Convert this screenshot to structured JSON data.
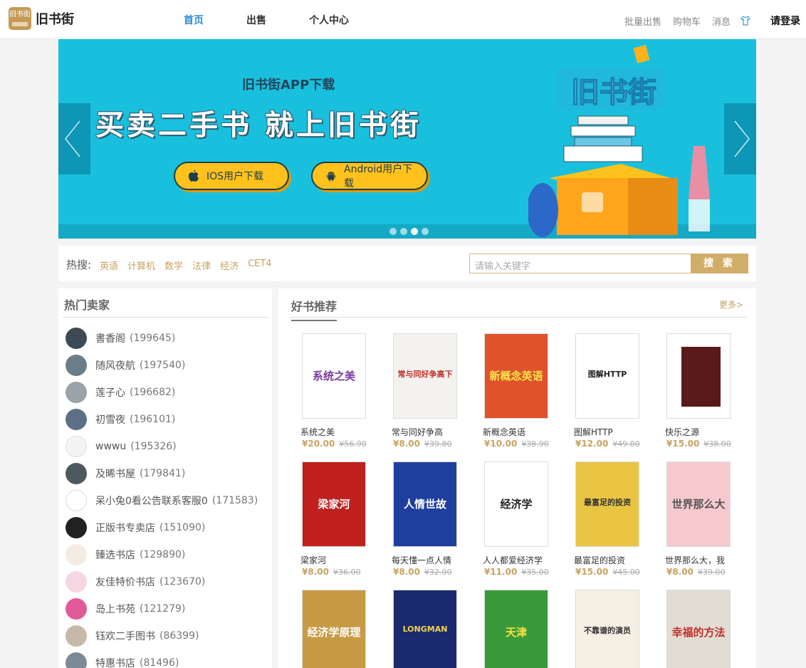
{
  "header": {
    "logo_mark_text": "旧书街",
    "logo_text": "旧书街",
    "nav": [
      {
        "label": "首页",
        "active": true
      },
      {
        "label": "出售",
        "active": false
      },
      {
        "label": "个人中心",
        "active": false
      }
    ],
    "links": {
      "bulk": "批量出售",
      "cart": "购物车",
      "messages": "消息",
      "login": "请登录"
    }
  },
  "banner": {
    "subtitle": "旧书街APP下载",
    "title": "买卖二手书 就上旧书街",
    "ios_label": "IOS用户下载",
    "android_label": "Android用户下载",
    "art_text": "旧书街",
    "slide_count": 4,
    "active_slide": 3
  },
  "search": {
    "hot_label": "热搜:",
    "hot_tags": [
      "英语",
      "计算机",
      "数学",
      "法律",
      "经济",
      "CET4"
    ],
    "placeholder": "请输入关键字",
    "button_label": "搜 索"
  },
  "sellers": {
    "title": "热门卖家",
    "items": [
      {
        "name": "書香阁",
        "count": "(199645)"
      },
      {
        "name": "随风夜航",
        "count": "(197540)"
      },
      {
        "name": "莲子心",
        "count": "(196682)"
      },
      {
        "name": "初雪夜",
        "count": "(196101)"
      },
      {
        "name": "wwwu",
        "count": "(195326)"
      },
      {
        "name": "及晞书屋",
        "count": "(179841)"
      },
      {
        "name": "呆小兔0看公告联系客服0",
        "count": "(171583)"
      },
      {
        "name": "正版书专卖店",
        "count": "(151090)"
      },
      {
        "name": "臻选书店",
        "count": "(129890)"
      },
      {
        "name": "友佳特价书店",
        "count": "(123670)"
      },
      {
        "name": "岛上书苑",
        "count": "(121279)"
      },
      {
        "name": "钰欢二手图书",
        "count": "(86399)"
      },
      {
        "name": "特惠书店",
        "count": "(81496)"
      }
    ]
  },
  "books": {
    "title": "好书推荐",
    "more": "更多>",
    "items": [
      {
        "title": "系统之美",
        "price": "¥20.00",
        "old_price": "¥56.90",
        "cover_text": "系统之美",
        "cover_color": "#ffffff",
        "text_color": "#7a3aa0"
      },
      {
        "title": "常与同好争高",
        "price": "¥8.00",
        "old_price": "¥39.80",
        "cover_text": "常与同好争高下",
        "cover_color": "#f4f2ee",
        "text_color": "#c0302a"
      },
      {
        "title": "新概念英语",
        "price": "¥10.00",
        "old_price": "¥38.90",
        "cover_text": "新概念英语",
        "cover_color": "#e0522b",
        "text_color": "#f7e44a"
      },
      {
        "title": "图解HTTP",
        "price": "¥12.00",
        "old_price": "¥49.00",
        "cover_text": "图解HTTP",
        "cover_color": "#ffffff",
        "text_color": "#222222"
      },
      {
        "title": "快乐之源",
        "price": "¥15.00",
        "old_price": "¥38.00",
        "cover_text": "",
        "cover_color": "#ffffff",
        "text_color": "#5a1a1a"
      },
      {
        "title": "梁家河",
        "price": "¥8.00",
        "old_price": "¥36.00",
        "cover_text": "梁家河",
        "cover_color": "#c0201e",
        "text_color": "#ffffff"
      },
      {
        "title": "每天懂一点人情",
        "price": "¥8.00",
        "old_price": "¥32.00",
        "cover_text": "人情世故",
        "cover_color": "#1e3f9e",
        "text_color": "#ffffff"
      },
      {
        "title": "人人都爱经济学",
        "price": "¥11.00",
        "old_price": "¥35.00",
        "cover_text": "经济学",
        "cover_color": "#ffffff",
        "text_color": "#222222"
      },
      {
        "title": "最富足的投资",
        "price": "¥15.00",
        "old_price": "¥45.00",
        "cover_text": "最富足的投资",
        "cover_color": "#e9c543",
        "text_color": "#333333"
      },
      {
        "title": "世界那么大，我",
        "price": "¥8.00",
        "old_price": "¥39.00",
        "cover_text": "世界那么大",
        "cover_color": "#f6c9cf",
        "text_color": "#555555"
      },
      {
        "title": "",
        "price": "",
        "old_price": "",
        "cover_text": "经济学原理",
        "cover_color": "#c79a45",
        "text_color": "#ffffff"
      },
      {
        "title": "",
        "price": "",
        "old_price": "",
        "cover_text": "LONGMAN",
        "cover_color": "#1a2a6e",
        "text_color": "#f5d34a"
      },
      {
        "title": "",
        "price": "",
        "old_price": "",
        "cover_text": "天津",
        "cover_color": "#3a9a3a",
        "text_color": "#f7e04a"
      },
      {
        "title": "",
        "price": "",
        "old_price": "",
        "cover_text": "不靠谱的演员",
        "cover_color": "#f5f0e4",
        "text_color": "#333333"
      },
      {
        "title": "",
        "price": "",
        "old_price": "",
        "cover_text": "幸福的方法",
        "cover_color": "#e2ddd4",
        "text_color": "#c0302a"
      }
    ]
  },
  "colors": {
    "accent": "#2d8bd5",
    "gold": "#c9a262",
    "banner": "#19c0de",
    "button": "#d1ad6a"
  }
}
